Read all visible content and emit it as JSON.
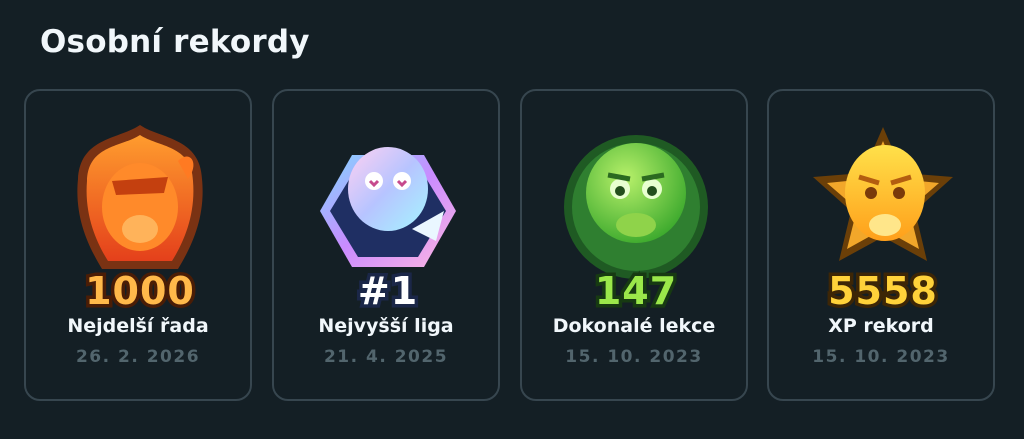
{
  "section": {
    "title": "Osobní rekordy"
  },
  "records": [
    {
      "value": "1000",
      "label": "Nejdelší řada",
      "date": "26. 2. 2026",
      "badge_icon": "streak-owl-flame-badge-icon",
      "value_color": "#ffb94a",
      "value_stroke": "#4a1d06"
    },
    {
      "value": "#1",
      "label": "Nejvyšší liga",
      "date": "21. 4. 2025",
      "badge_icon": "diamond-league-owl-badge-icon",
      "value_color": "#ffffff",
      "value_stroke": "#1b2748"
    },
    {
      "value": "147",
      "label": "Dokonalé lekce",
      "date": "15. 10. 2023",
      "badge_icon": "perfect-lessons-owl-badge-icon",
      "value_color": "#9be84a",
      "value_stroke": "#173a12"
    },
    {
      "value": "5558",
      "label": "XP rekord",
      "date": "15. 10. 2023",
      "badge_icon": "xp-owl-star-badge-icon",
      "value_color": "#ffd23a",
      "value_stroke": "#3d2606"
    }
  ]
}
